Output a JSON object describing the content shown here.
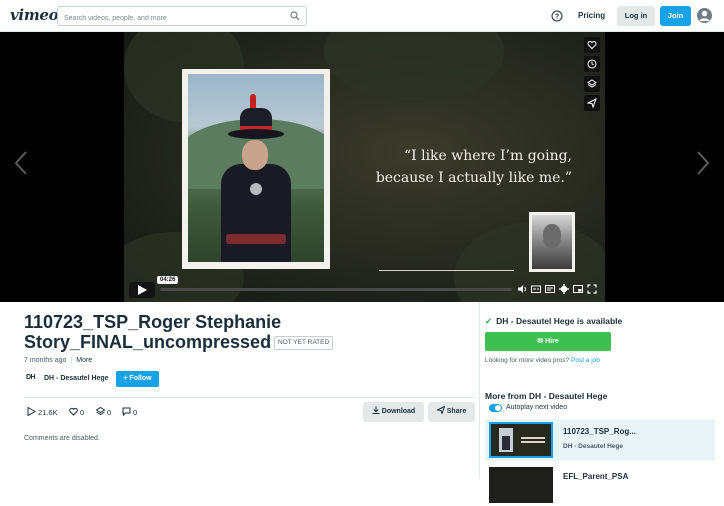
{
  "header": {
    "logo": "vimeo",
    "search_placeholder": "Search videos, people, and more",
    "pricing": "Pricing",
    "login": "Log in",
    "join": "Join"
  },
  "player": {
    "quote_line1": "“I like where I’m going,",
    "quote_line2": "because I actually like me.”",
    "timecode": "04:26",
    "progress_fraction": 0.0
  },
  "video": {
    "title": "110723_TSP_Roger Stephanie Story_FINAL_uncompressed",
    "rating_badge": "NOT YET RATED",
    "age": "7 months ago",
    "more": "More",
    "channel_logo": "DH",
    "channel_name": "DH - Desautel Hege",
    "follow": "+ Follow",
    "stats": {
      "plays": "21.6K",
      "likes": "0",
      "collections": "0",
      "comments": "0"
    },
    "download": "Download",
    "share": "Share",
    "comments_note": "Comments are disabled."
  },
  "sidebar": {
    "available": "DH - Desautel Hege is available",
    "hire": "Hire",
    "lookfor_text": "Looking for more video pros?",
    "post_job": "Post a job",
    "more_from": "More from DH - Desautel Hege",
    "autoplay": "Autoplay next video",
    "recs": [
      {
        "title": "110723_TSP_Rog...",
        "channel": "DH - Desautel Hege"
      },
      {
        "title": "EFL_Parent_PSA",
        "channel": ""
      }
    ]
  },
  "colors": {
    "accent": "#17a1e6",
    "hire_green": "#3fbf4f",
    "text_dark": "#1a2e3b"
  }
}
